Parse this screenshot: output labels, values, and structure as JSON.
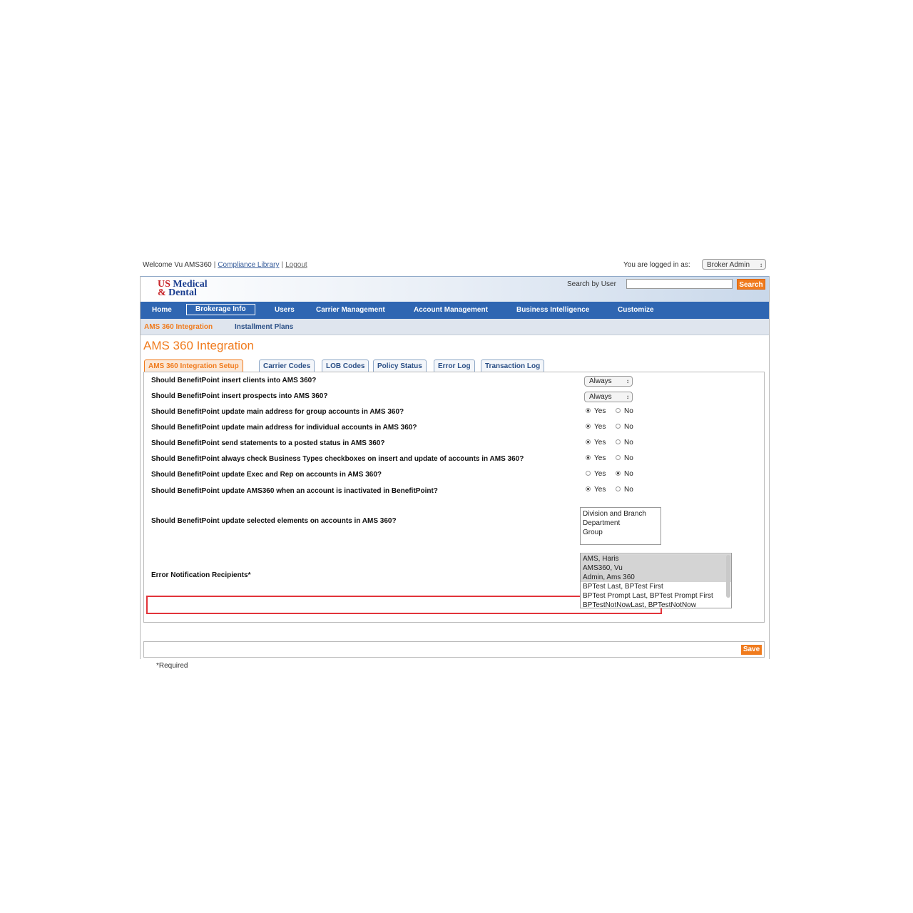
{
  "topbar": {
    "welcome": "Welcome Vu AMS360",
    "compliance_link": "Compliance Library",
    "logout_link": "Logout",
    "logged_in_label": "You are logged in as:",
    "role": "Broker Admin"
  },
  "header": {
    "logo_line1_a": "US",
    "logo_line1_b": " Medical",
    "logo_line2_a": "&",
    "logo_line2_b": " Dental",
    "search_label": "Search by User",
    "search_value": "",
    "search_button": "Search"
  },
  "mainnav": {
    "home": "Home",
    "brokerage": "Brokerage Info",
    "users": "Users",
    "carrier": "Carrier Management",
    "account": "Account Management",
    "bi": "Business Intelligence",
    "customize": "Customize"
  },
  "subnav": {
    "ams": "AMS 360 Integration",
    "installment": "Installment Plans"
  },
  "page_title": "AMS 360 Integration",
  "tabs": {
    "setup": "AMS 360 Integration Setup",
    "carrier_codes": "Carrier Codes",
    "lob_codes": "LOB Codes",
    "policy_status": "Policy Status",
    "error_log": "Error Log",
    "transaction_log": "Transaction Log"
  },
  "questions": {
    "q1": "Should BenefitPoint insert clients into AMS 360?",
    "q2": "Should BenefitPoint insert prospects into AMS 360?",
    "q3": "Should BenefitPoint update main address for group accounts in AMS 360?",
    "q4": "Should BenefitPoint update main address for individual accounts in AMS 360?",
    "q5": "Should BenefitPoint send statements to a posted status in AMS 360?",
    "q6": "Should BenefitPoint always check Business Types checkboxes on insert and update of accounts in AMS 360?",
    "q7": "Should BenefitPoint update Exec and Rep on accounts in AMS 360?",
    "q8": "Should BenefitPoint update AMS360 when an account is inactivated in BenefitPoint?",
    "q9": "Should BenefitPoint update selected elements on accounts in AMS 360?",
    "q10": "Error Notification Recipients*"
  },
  "answers": {
    "q1": "Always",
    "q2": "Always",
    "yes": "Yes",
    "no": "No"
  },
  "elements_options": [
    "Division and Branch",
    "Department",
    "Group"
  ],
  "recipients_options": [
    "AMS, Haris",
    "AMS360, Vu",
    "Admin, Ams 360",
    "BPTest Last, BPTest First",
    "BPTest Prompt Last, BPTest Prompt First",
    "BPTestNotNowLast, BPTestNotNow"
  ],
  "save_button": "Save",
  "required_note": "*Required"
}
